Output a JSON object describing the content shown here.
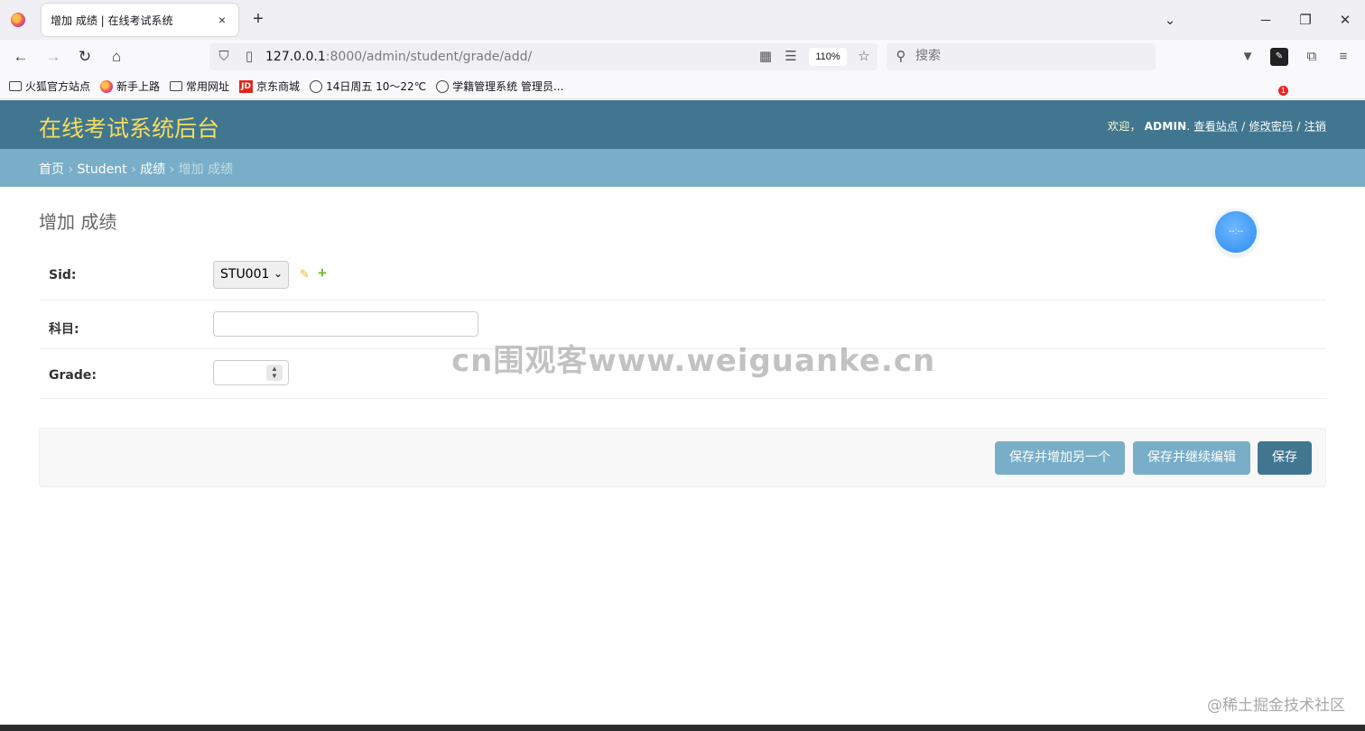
{
  "browser": {
    "tab_title": "增加 成绩 | 在线考试系统",
    "tab_close": "×",
    "new_tab": "+",
    "url_host": "127.0.0.1",
    "url_path": ":8000/admin/student/grade/add/",
    "zoom": "110%",
    "search_placeholder": "搜索",
    "extension_badge": "1",
    "bookmarks": [
      "火狐官方站点",
      "新手上路",
      "常用网址",
      "京东商城",
      "14日周五  10～22℃",
      "学籍管理系统 管理员..."
    ]
  },
  "admin": {
    "site_title": "在线考试系统后台",
    "welcome": "欢迎，",
    "username": "ADMIN",
    "view_site": "查看站点",
    "change_password": "修改密码",
    "logout": "注销",
    "sep": " / "
  },
  "breadcrumbs": {
    "home": "首页",
    "app": "Student",
    "model": "成绩",
    "current": "增加 成绩",
    "sep": " › "
  },
  "form": {
    "heading": "增加 成绩",
    "sid_label": "Sid:",
    "sid_value": "STU001",
    "subject_label": "科目:",
    "subject_value": "",
    "grade_label": "Grade:",
    "grade_value": ""
  },
  "buttons": {
    "save_add_another": "保存并增加另一个",
    "save_continue": "保存并继续编辑",
    "save": "保存"
  },
  "overlay": {
    "watermark": "cn围观客www.weiguanke.cn",
    "juejin": "@稀土掘金技术社区",
    "float_ball": "--:--"
  },
  "colors": {
    "header": "#417690",
    "breadcrumbs": "#79aec8",
    "branding": "#f5dd5d"
  }
}
